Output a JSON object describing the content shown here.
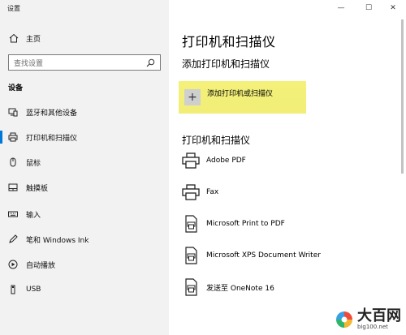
{
  "window": {
    "title": "设置",
    "controls": {
      "minimize": "—",
      "maximize": "☐",
      "close": "✕"
    }
  },
  "sidebar": {
    "home_label": "主页",
    "search_placeholder": "查找设置",
    "section_title": "设备",
    "items": [
      {
        "label": "蓝牙和其他设备",
        "icon": "bluetooth-devices-icon"
      },
      {
        "label": "打印机和扫描仪",
        "icon": "printer-icon",
        "active": true
      },
      {
        "label": "鼠标",
        "icon": "mouse-icon"
      },
      {
        "label": "触摸板",
        "icon": "touchpad-icon"
      },
      {
        "label": "输入",
        "icon": "keyboard-icon"
      },
      {
        "label": "笔和 Windows Ink",
        "icon": "pen-icon"
      },
      {
        "label": "自动播放",
        "icon": "autoplay-icon"
      },
      {
        "label": "USB",
        "icon": "usb-icon"
      }
    ]
  },
  "main": {
    "page_title": "打印机和扫描仪",
    "add_section_title": "添加打印机和扫描仪",
    "add_button_label": "添加打印机或扫描仪",
    "list_section_title": "打印机和扫描仪",
    "printers": [
      {
        "name": "Adobe PDF",
        "icon": "printer-icon"
      },
      {
        "name": "Fax",
        "icon": "printer-icon"
      },
      {
        "name": "Microsoft Print to PDF",
        "icon": "document-printer-icon"
      },
      {
        "name": "Microsoft XPS Document Writer",
        "icon": "document-printer-icon"
      },
      {
        "name": "发送至 OneNote 16",
        "icon": "document-printer-icon"
      }
    ]
  },
  "watermark": {
    "brand": "大百网",
    "url": "big100.net"
  },
  "colors": {
    "accent": "#0078d7",
    "highlight": "#f1ee78",
    "sidebar_bg": "#f2f2f2"
  }
}
